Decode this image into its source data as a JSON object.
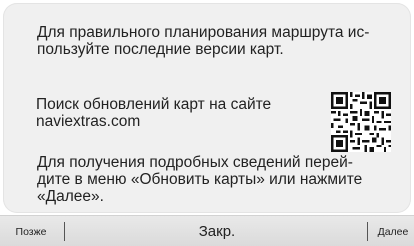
{
  "dialog": {
    "message_plan": "Для правильного планирования маршрута ис-\nпользуйте последние версии карт.",
    "message_search": "Поиск обновлений карт на сайте\nnaviextras.com",
    "message_details": "Для получения подробных сведений перей-\nдите в меню «Обновить карты» или нажмите\n«Далее».",
    "qr_icon": "qr-code-icon"
  },
  "buttons": {
    "later": "Позже",
    "close": "Закр.",
    "next": "Далее"
  },
  "colors": {
    "panel": "#f0f0f0",
    "button_bar": "#e2e2e2",
    "text": "#222222"
  }
}
